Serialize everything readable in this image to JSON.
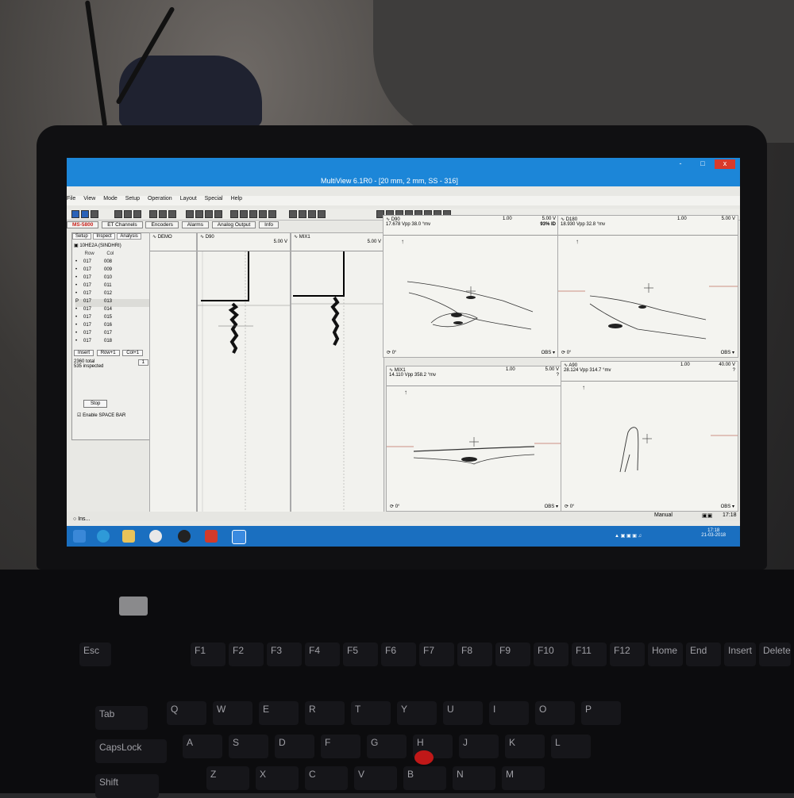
{
  "window": {
    "title": "MultiView 6.1R0 - [20 mm, 2 mm, SS - 316]",
    "controls": [
      "-",
      "□",
      "x"
    ]
  },
  "menu": [
    "File",
    "View",
    "Mode",
    "Setup",
    "Operation",
    "Layout",
    "Special",
    "Help"
  ],
  "tabs": [
    "MS-5800",
    "ET Channels",
    "Encoders",
    "Alarms",
    "Analog Output",
    "Info"
  ],
  "left_panel": {
    "tabs": [
      "Setup",
      "Inspect",
      "Analysis"
    ],
    "folder": "10HE2A (SINDHRI)",
    "columns": [
      "Row",
      "Col"
    ],
    "rows": [
      {
        "marker": "•",
        "row": "017",
        "col": "008"
      },
      {
        "marker": "•",
        "row": "017",
        "col": "009"
      },
      {
        "marker": "•",
        "row": "017",
        "col": "010"
      },
      {
        "marker": "•",
        "row": "017",
        "col": "011"
      },
      {
        "marker": "•",
        "row": "017",
        "col": "012"
      },
      {
        "marker": "P",
        "row": "017",
        "col": "013"
      },
      {
        "marker": "•",
        "row": "017",
        "col": "014"
      },
      {
        "marker": "•",
        "row": "017",
        "col": "015"
      },
      {
        "marker": "•",
        "row": "017",
        "col": "016"
      },
      {
        "marker": "•",
        "row": "017",
        "col": "017"
      },
      {
        "marker": "•",
        "row": "017",
        "col": "018"
      }
    ],
    "buttons": [
      "Insert",
      "Row+1",
      "Col+1"
    ],
    "step_value": "1",
    "total": "2360 total",
    "inspected": "535 inspected",
    "stop_button": "Stop",
    "space_bar_checkbox": "Enable SPACE BAR"
  },
  "strips": [
    {
      "name": "DEMO",
      "scale": ""
    },
    {
      "name": "D90",
      "scale": "5.00 V"
    },
    {
      "name": "MIX1",
      "scale": "5.00 V"
    }
  ],
  "lissajous": [
    {
      "name": "D90",
      "vpp": "17.678 Vpp",
      "angle": "38.0 °mv",
      "ratio": "1.00",
      "scale": "5.00 V",
      "extra": "93% ID",
      "footer_angle": "0°",
      "footer_right": "OBS"
    },
    {
      "name": "D180",
      "vpp": "18.930 Vpp",
      "angle": "32.8 °mv",
      "ratio": "1.00",
      "scale": "5.00 V",
      "extra": "",
      "footer_angle": "0°",
      "footer_right": "OBS"
    },
    {
      "name": "MIX1",
      "vpp": "14.110 Vpp",
      "angle": "358.2 °mv",
      "ratio": "1.00",
      "scale": "5.00 V",
      "extra": "?",
      "footer_angle": "0°",
      "footer_right": "OBS"
    },
    {
      "name": "A90",
      "vpp": "28.124 Vpp",
      "angle": "314.7 °mv",
      "ratio": "1.00",
      "scale": "40.00 V",
      "extra": "?",
      "footer_angle": "0°",
      "footer_right": "OBS"
    }
  ],
  "status_bar": {
    "mode": "Manual",
    "time": "17:18"
  },
  "taskbar": {
    "app_label": "Ins...",
    "clock_time": "17:18",
    "clock_date": "21-03-2018"
  },
  "keyboard": {
    "row1": [
      "Esc",
      "F1",
      "F2",
      "F3",
      "F4",
      "F5",
      "F6",
      "F7",
      "F8",
      "F9",
      "F10",
      "F11",
      "F12",
      "Home",
      "End",
      "Insert",
      "Delete"
    ],
    "row3": [
      "Tab",
      "Q",
      "W",
      "E",
      "R",
      "T",
      "Y",
      "U",
      "I",
      "O",
      "P"
    ],
    "row4": [
      "CapsLock",
      "A",
      "S",
      "D",
      "F",
      "G",
      "H",
      "J",
      "K",
      "L"
    ],
    "row5": [
      "Shift",
      "Z",
      "X",
      "C",
      "V",
      "B",
      "N",
      "M"
    ]
  }
}
